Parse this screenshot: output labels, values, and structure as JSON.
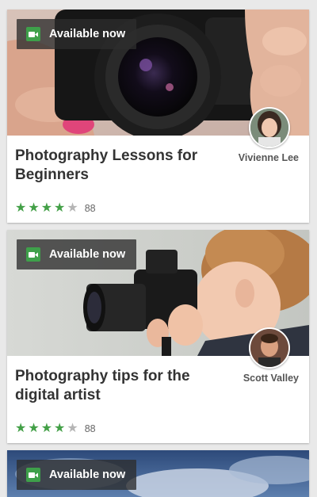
{
  "cards": [
    {
      "badge_label": "Available now",
      "title": "Photography Lessons for Beginners",
      "author": "Vivienne Lee",
      "rating": {
        "stars_filled": 4,
        "stars_total": 5,
        "count": "88"
      }
    },
    {
      "badge_label": "Available now",
      "title": "Photography tips for the digital artist",
      "author": "Scott Valley",
      "rating": {
        "stars_filled": 4,
        "stars_total": 5,
        "count": "88"
      }
    },
    {
      "badge_label": "Available now"
    }
  ],
  "colors": {
    "accent_green": "#43a047",
    "badge_bg": "#2d2d2d",
    "page_bg": "#e9e9e9"
  },
  "icons": {
    "badge": "video-camera-icon",
    "star": "star-icon"
  }
}
